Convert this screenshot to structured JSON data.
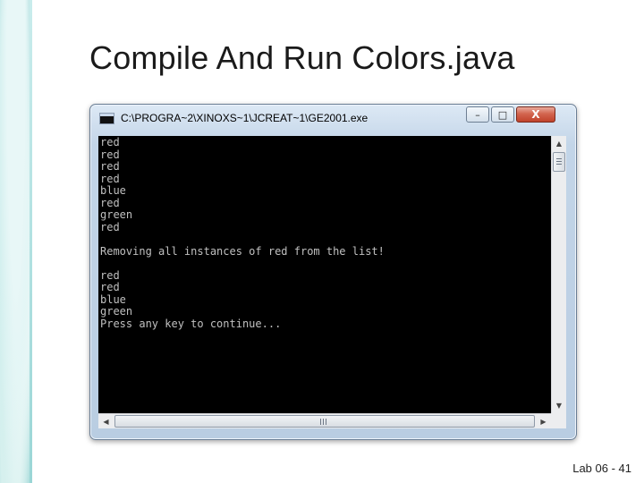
{
  "slide": {
    "title": "Compile And Run Colors.java",
    "footer": "Lab 06 - 41"
  },
  "window": {
    "title": "C:\\PROGRA~2\\XINOXS~1\\JCREAT~1\\GE2001.exe",
    "minimize_label": "–",
    "maximize_label": "□",
    "close_label": "X",
    "icon": "console-window-icon"
  },
  "console": {
    "background": "#000000",
    "text_color": "#c0c0c0",
    "lines": [
      "red",
      "red",
      "red",
      "red",
      "blue",
      "red",
      "green",
      "red",
      "",
      "Removing all instances of red from the list!",
      "",
      "red",
      "red",
      "blue",
      "green",
      "Press any key to continue..."
    ]
  },
  "scrollbars": {
    "up_arrow": "▲",
    "down_arrow": "▼",
    "left_arrow": "◀",
    "right_arrow": "▶"
  },
  "colors": {
    "window_frame": "#c3d5e8",
    "close_button": "#c0432b",
    "side_strip": "#8fd0d1"
  }
}
